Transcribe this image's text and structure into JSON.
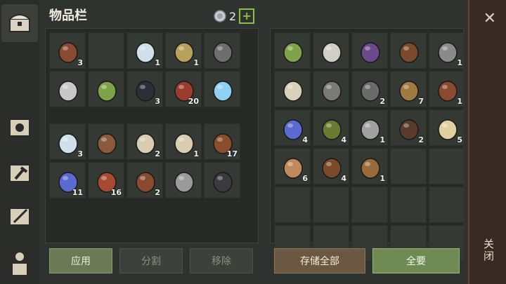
{
  "header": {
    "title": "物品栏",
    "coin_count": "2",
    "add_label": "+"
  },
  "buttons": {
    "apply": "应用",
    "split": "分割",
    "remove": "移除",
    "store_all": "存储全部",
    "take_all": "全要"
  },
  "close": {
    "label": "关闭"
  },
  "left_grid_top": [
    {
      "name": "flask",
      "qty": "3"
    },
    {
      "name": "empty",
      "qty": ""
    },
    {
      "name": "potion",
      "qty": "1"
    },
    {
      "name": "grain",
      "qty": "1"
    },
    {
      "name": "helmet",
      "qty": ""
    },
    {
      "name": "sword",
      "qty": ""
    },
    {
      "name": "spear-tip",
      "qty": ""
    },
    {
      "name": "coal",
      "qty": "3"
    },
    {
      "name": "meat",
      "qty": "20"
    },
    {
      "name": "ice-blade",
      "qty": ""
    }
  ],
  "left_grid_bottom": [
    {
      "name": "potion",
      "qty": "3"
    },
    {
      "name": "tunic",
      "qty": ""
    },
    {
      "name": "scroll",
      "qty": "2"
    },
    {
      "name": "scroll",
      "qty": "1"
    },
    {
      "name": "leather",
      "qty": "17"
    },
    {
      "name": "crystal",
      "qty": "11"
    },
    {
      "name": "bacon",
      "qty": "16"
    },
    {
      "name": "bottle",
      "qty": "2"
    },
    {
      "name": "halberd",
      "qty": ""
    },
    {
      "name": "boots",
      "qty": ""
    }
  ],
  "right_grid": [
    {
      "name": "spear-tip",
      "qty": ""
    },
    {
      "name": "scimitar",
      "qty": ""
    },
    {
      "name": "rune-book",
      "qty": ""
    },
    {
      "name": "mask-book",
      "qty": ""
    },
    {
      "name": "clamp",
      "qty": "1"
    },
    {
      "name": "map-scroll",
      "qty": ""
    },
    {
      "name": "shield",
      "qty": ""
    },
    {
      "name": "gear",
      "qty": "2"
    },
    {
      "name": "sack",
      "qty": "7"
    },
    {
      "name": "bottle",
      "qty": "1"
    },
    {
      "name": "crystal",
      "qty": "4"
    },
    {
      "name": "ball",
      "qty": "4"
    },
    {
      "name": "spoon",
      "qty": "1"
    },
    {
      "name": "trap",
      "qty": "2"
    },
    {
      "name": "candle",
      "qty": "5"
    },
    {
      "name": "cloth",
      "qty": "6"
    },
    {
      "name": "mug",
      "qty": "4"
    },
    {
      "name": "barrel",
      "qty": "1"
    },
    {
      "name": "empty",
      "qty": ""
    },
    {
      "name": "empty",
      "qty": ""
    },
    {
      "name": "empty",
      "qty": ""
    },
    {
      "name": "empty",
      "qty": ""
    },
    {
      "name": "empty",
      "qty": ""
    },
    {
      "name": "empty",
      "qty": ""
    },
    {
      "name": "empty",
      "qty": ""
    },
    {
      "name": "empty",
      "qty": ""
    },
    {
      "name": "empty",
      "qty": ""
    },
    {
      "name": "empty",
      "qty": ""
    },
    {
      "name": "empty",
      "qty": ""
    },
    {
      "name": "empty",
      "qty": ""
    }
  ],
  "colors": {
    "accent_green": "#8bbf4a",
    "rarity_orange": "#d9893a",
    "rarity_blue": "#5aa9d6",
    "rarity_tan": "#c9b48a"
  }
}
